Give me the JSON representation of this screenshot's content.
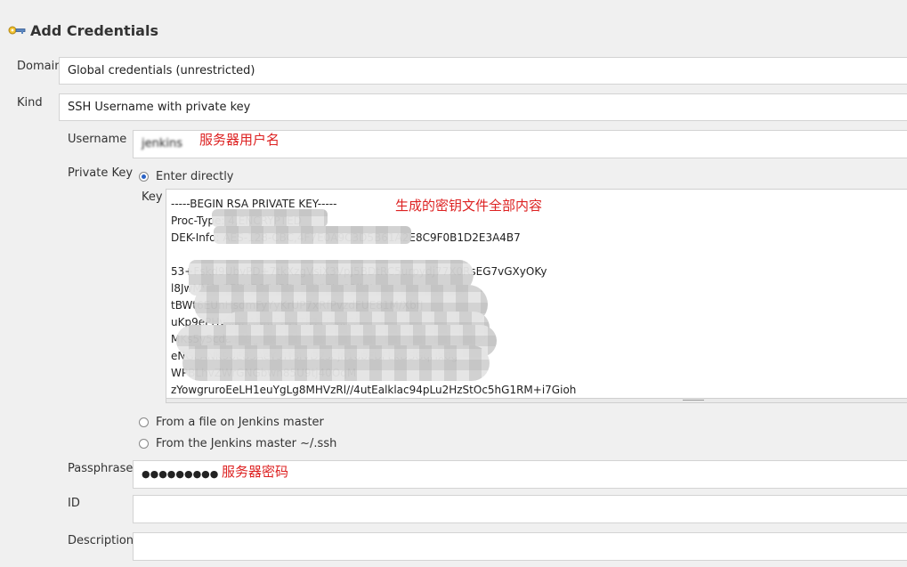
{
  "page": {
    "title": "Add Credentials",
    "icon": "key-icon"
  },
  "domain": {
    "label": "Domain",
    "value": "Global credentials (unrestricted)"
  },
  "kind": {
    "label": "Kind",
    "value": "SSH Username with private key"
  },
  "username": {
    "label": "Username",
    "value": "jenkins",
    "annotation": "服务器用户名"
  },
  "private_key": {
    "label": "Private Key",
    "options": [
      {
        "label": "Enter directly",
        "checked": true
      },
      {
        "label": "From a file on Jenkins master",
        "checked": false
      },
      {
        "label": "From the Jenkins master ~/.ssh",
        "checked": false
      }
    ],
    "key_label": "Key",
    "annotation": "生成的密钥文件全部内容",
    "key_lines": [
      "-----BEGIN RSA PRIVATE KEY-----",
      "Proc-Type: 4,ENCRYPTED",
      "DEK-Info: AES-128-CBC,4F7E0A9C3D5B61A2E8C9F0B1D2E3A4B7",
      "",
      "53+Fskd9UbvPD+7tkXzgVsiX3VpJ5BDtRC5urpydj77X0RsEG7vGXyOKy",
      "l8JwMV4u2EEUB87dR7aSzfYiCtn92lkY",
      "tBWt6EUnHsdmFyYyKrUP7xRfPvzdFUE81M/XbfJ",
      "uKp9ePHvsIdZARmFy34TK1YEmrE/",
      "MKs5y5cda609gk8eMRfh4bs",
      "eNGLANK90E83AeYsTfSfVD2sEjh16bEBFLkDSGqHx0g",
      "WPBLhvZWrGNGbwn85U9tj40OqM",
      "zYowgruroEeLH1euYgLg8MHVzRl//4utEalklac94pLu2HzStOc5hG1RM+i7Gioh"
    ]
  },
  "passphrase": {
    "label": "Passphrase",
    "value": "●●●●●●●●●",
    "annotation": "服务器密码"
  },
  "id_field": {
    "label": "ID",
    "value": ""
  },
  "description": {
    "label": "Description",
    "value": ""
  }
}
